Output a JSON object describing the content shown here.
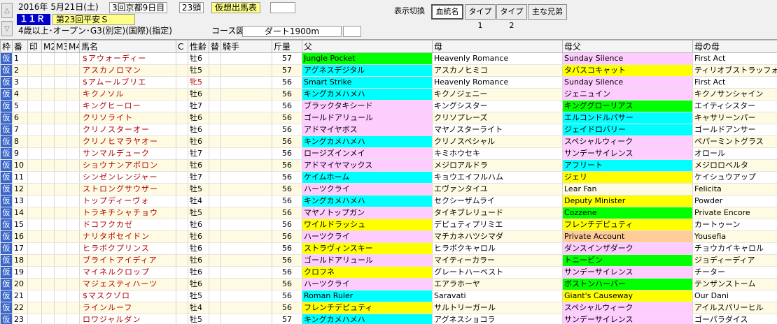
{
  "header": {
    "date": "2016年 5月21日(土)",
    "meeting": "3回京都9日目",
    "runners": "23頭",
    "card_type": "仮想出馬表",
    "race_no": "１１Ｒ",
    "race_name": "第23回平安Ｓ",
    "conditions": "4歳以上･オープン･G3(別定)(国際)(指定)",
    "course_label": "コース図",
    "course": "ダート1900m",
    "ctl_up": "△",
    "ctl_down": "▽",
    "view_toggle_label": "表示切換",
    "buttons": [
      "血統名",
      "タイプ1",
      "タイプ2",
      "主な兄弟"
    ],
    "active_button": 0
  },
  "columns": [
    "枠",
    "番",
    "印",
    "M2",
    "M3",
    "M4",
    "馬名",
    "C",
    "性齢",
    "替",
    "騎手",
    "斤量",
    "父",
    "母",
    "母父",
    "母の母"
  ],
  "frame_label": "仮",
  "colors": {
    "green": "#00ff00",
    "cyan": "#00ffff",
    "pink": "#ffccff",
    "yellow": "#ffff00",
    "orange": "#ffcc99",
    "frame": "#3b66c9"
  },
  "rows": [
    {
      "no": "1",
      "name": "$アウォーディー",
      "sexage": "牡6",
      "weight": "57",
      "sire": "Jungle Pocket",
      "sire_c": "green",
      "dam": "Heavenly Romance",
      "damsire": "Sunday Silence",
      "damsire_c": "pink",
      "dd": "First Act"
    },
    {
      "no": "2",
      "name": "アスカノロマン",
      "sexage": "牡5",
      "weight": "57",
      "sire": "アグネスデジタル",
      "sire_c": "cyan",
      "dam": "アスカノヒミコ",
      "damsire": "タバスコキャット",
      "damsire_c": "yellow",
      "dd": "ティリオブストラッフォード"
    },
    {
      "no": "3",
      "name": "$アムールブリエ",
      "sexage": "牝5",
      "filly": true,
      "weight": "56",
      "sire": "Smart Strike",
      "sire_c": "cyan",
      "dam": "Heavenly Romance",
      "damsire": "Sunday Silence",
      "damsire_c": "pink",
      "dd": "First Act"
    },
    {
      "no": "4",
      "name": "キクノソル",
      "sexage": "牡6",
      "weight": "56",
      "sire": "キングカメハメハ",
      "sire_c": "cyan",
      "dam": "キクノジェニー",
      "damsire": "ジェニュイン",
      "damsire_c": "pink",
      "dd": "キクノサンシャイン"
    },
    {
      "no": "5",
      "name": "キングヒーロー",
      "sexage": "牡7",
      "weight": "56",
      "sire": "ブラックタキシード",
      "sire_c": "pink",
      "dam": "キングシスター",
      "damsire": "キンググローリアス",
      "damsire_c": "green",
      "dd": "エイティシスター"
    },
    {
      "no": "6",
      "name": "クリソライト",
      "sexage": "牡6",
      "weight": "56",
      "sire": "ゴールドアリュール",
      "sire_c": "pink",
      "dam": "クリソプレーズ",
      "damsire": "エルコンドルパサー",
      "damsire_c": "cyan",
      "dd": "キャサリーンパー"
    },
    {
      "no": "7",
      "name": "クリノスターオー",
      "sexage": "牡6",
      "weight": "56",
      "sire": "アドマイヤボス",
      "sire_c": "pink",
      "dam": "マヤノスターライト",
      "damsire": "ジェイドロバリー",
      "damsire_c": "cyan",
      "dd": "ゴールドアンサー"
    },
    {
      "no": "8",
      "name": "クリノヒマラヤオー",
      "sexage": "牡6",
      "weight": "56",
      "sire": "キングカメハメハ",
      "sire_c": "cyan",
      "dam": "クリノスペシャル",
      "damsire": "スペシャルウィーク",
      "damsire_c": "pink",
      "dd": "ペパーミントグラス"
    },
    {
      "no": "9",
      "name": "サンマルデューク",
      "sexage": "牡7",
      "weight": "56",
      "sire": "ロージズインメイ",
      "sire_c": "pink",
      "dam": "キミホウセキ",
      "damsire": "サンデーサイレンス",
      "damsire_c": "pink",
      "dd": "オロール"
    },
    {
      "no": "10",
      "name": "ショウナンアポロン",
      "sexage": "牡6",
      "weight": "56",
      "sire": "アドマイヤマックス",
      "sire_c": "pink",
      "dam": "メジロアルドラ",
      "damsire": "アフリート",
      "damsire_c": "cyan",
      "dd": "メジロロベルタ"
    },
    {
      "no": "11",
      "name": "シンゼンレンジャー",
      "sexage": "牡7",
      "weight": "56",
      "sire": "ケイムホーム",
      "sire_c": "cyan",
      "dam": "キョウエイフルハム",
      "damsire": "ジェリ",
      "damsire_c": "yellow",
      "dd": "ケイシュウアップ"
    },
    {
      "no": "12",
      "name": "ストロングサウザー",
      "sexage": "牡5",
      "weight": "56",
      "sire": "ハーツクライ",
      "sire_c": "pink",
      "dam": "エヴァンタイユ",
      "damsire": "Lear Fan",
      "damsire_c": "white",
      "dd": "Felicita"
    },
    {
      "no": "13",
      "name": "トップディーヴォ",
      "sexage": "牡4",
      "weight": "56",
      "sire": "キングカメハメハ",
      "sire_c": "cyan",
      "dam": "セクシーザムライ",
      "damsire": "Deputy Minister",
      "damsire_c": "yellow",
      "dd": "Powder"
    },
    {
      "no": "14",
      "name": "トラキチシャチョウ",
      "sexage": "牡5",
      "weight": "56",
      "sire": "マヤノトップガン",
      "sire_c": "pink",
      "dam": "タイキブレリュード",
      "damsire": "Cozzene",
      "damsire_c": "green",
      "dd": "Private Encore"
    },
    {
      "no": "15",
      "name": "ドコフクカゼ",
      "sexage": "牡6",
      "weight": "56",
      "sire": "ワイルドラッシュ",
      "sire_c": "yellow",
      "dam": "デピュティプリミエ",
      "damsire": "フレンチデピュティ",
      "damsire_c": "yellow",
      "dd": "カートゥーン"
    },
    {
      "no": "16",
      "name": "ナリタポセイドン",
      "sexage": "牡6",
      "weight": "56",
      "sire": "ハーツクライ",
      "sire_c": "pink",
      "dam": "マチカネハツシマダ",
      "damsire": "Private Account",
      "damsire_c": "orange",
      "dd": "Yousefia"
    },
    {
      "no": "17",
      "name": "ヒラボクプリンス",
      "sexage": "牡6",
      "weight": "56",
      "sire": "ストラヴィンスキー",
      "sire_c": "yellow",
      "dam": "ヒラボクキャロル",
      "damsire": "ダンスインザダーク",
      "damsire_c": "pink",
      "dd": "チョウカイキャロル"
    },
    {
      "no": "18",
      "name": "ブライトアイディア",
      "sexage": "牡6",
      "weight": "56",
      "sire": "ゴールドアリュール",
      "sire_c": "pink",
      "dam": "マイティーカラー",
      "damsire": "トニービン",
      "damsire_c": "green",
      "dd": "ジョディーディア"
    },
    {
      "no": "19",
      "name": "マイネルクロップ",
      "sexage": "牡6",
      "weight": "56",
      "sire": "クロフネ",
      "sire_c": "yellow",
      "dam": "グレートハーベスト",
      "damsire": "サンデーサイレンス",
      "damsire_c": "pink",
      "dd": "チーター"
    },
    {
      "no": "20",
      "name": "マジェスティハーツ",
      "sexage": "牡6",
      "weight": "56",
      "sire": "ハーツクライ",
      "sire_c": "pink",
      "dam": "エアラホーヤ",
      "damsire": "ボストンハーバー",
      "damsire_c": "green",
      "dd": "テンザンストーム"
    },
    {
      "no": "21",
      "name": "$マスクゾロ",
      "sexage": "牡5",
      "weight": "56",
      "sire": "Roman Ruler",
      "sire_c": "cyan",
      "dam": "Saravati",
      "damsire": "Giant's Causeway",
      "damsire_c": "yellow",
      "dd": "Our Dani"
    },
    {
      "no": "22",
      "name": "ラインルーフ",
      "sexage": "牡4",
      "weight": "56",
      "sire": "フレンチデピュティ",
      "sire_c": "yellow",
      "dam": "サルトリーガール",
      "damsire": "スペシャルウィーク",
      "damsire_c": "pink",
      "dd": "アイルスパリーヒル"
    },
    {
      "no": "23",
      "name": "ロワジャルダン",
      "sexage": "牡5",
      "weight": "57",
      "sire": "キングカメハメハ",
      "sire_c": "cyan",
      "dam": "アグネスショコラ",
      "damsire": "サンデーサイレンス",
      "damsire_c": "pink",
      "dd": "ゴーパラダイス"
    }
  ]
}
